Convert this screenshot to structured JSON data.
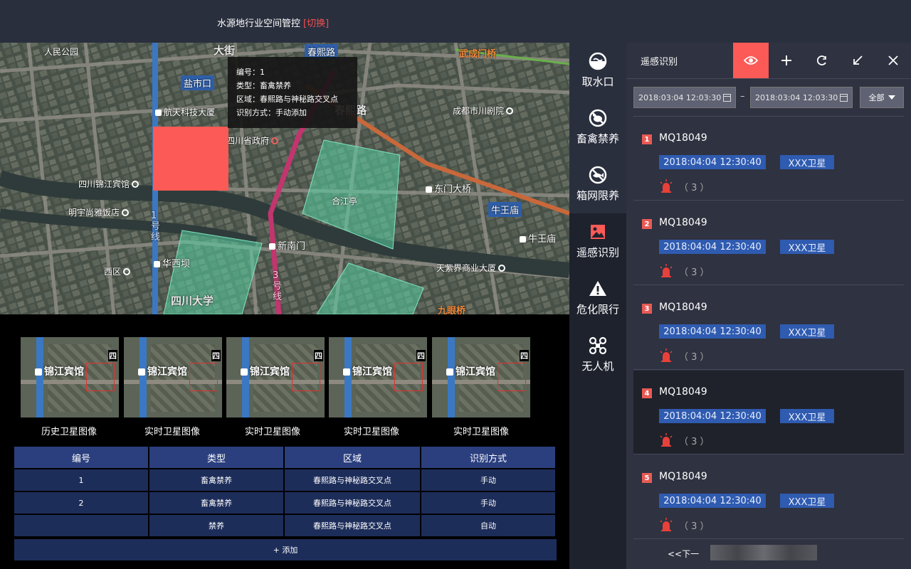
{
  "header": {
    "title": "水源地行业空间管控",
    "switch": "[切换]"
  },
  "map": {
    "labels": {
      "renmin_park": "人民公园",
      "da_jie": "大街",
      "chunxi_road_top": "春熙路",
      "wucheng_bridge": "武成门桥",
      "yanshikou": "盐市口",
      "aerospace_tower": "航天科技大厦",
      "chunxi_road_mid": "春熙路",
      "chengdu_theater": "成都市川剧院",
      "sichuan_gov": "四川省政府",
      "jinjiang_hotel": "四川锦江宾馆",
      "hejiang_pavilion": "合江亭",
      "dongmen_bridge": "东门大桥",
      "mingyu_hotel": "明宇尚雅饭店",
      "line1": "1号线",
      "niuwang_temple_badge": "牛王庙",
      "niuwang_temple": "牛王庙",
      "xinnanmen": "新南门",
      "huaxiba": "华西坝",
      "line3": "3号线",
      "xiqu": "西区",
      "tianzijie": "天紫界商业大厦",
      "sichuan_uni": "四川大学",
      "jiuyan_bridge": "九眼桥"
    },
    "tooltip": {
      "line1": "编号：1",
      "line2": "类型：畜禽禁养",
      "line3": "区域：春熙路与神秘路交叉点",
      "line4": "识别方式：手动添加"
    }
  },
  "thumbnails": [
    {
      "name": "锦江宾馆",
      "corner": "四",
      "caption": "历史卫星图像"
    },
    {
      "name": "锦江宾馆",
      "corner": "四",
      "caption": "实时卫星图像"
    },
    {
      "name": "锦江宾馆",
      "corner": "四",
      "caption": "实时卫星图像"
    },
    {
      "name": "锦江宾馆",
      "corner": "四",
      "caption": "实时卫星图像"
    },
    {
      "name": "锦江宾馆",
      "corner": "四",
      "caption": "实时卫星图像"
    }
  ],
  "table": {
    "headers": [
      "编号",
      "类型",
      "区域",
      "识别方式"
    ],
    "rows": [
      [
        "1",
        "畜禽禁养",
        "春熙路与神秘路交叉点",
        "手动"
      ],
      [
        "2",
        "畜禽禁养",
        "春熙路与神秘路交叉点",
        "手动"
      ],
      [
        "",
        "禁养",
        "春熙路与神秘路交叉点",
        "自动"
      ]
    ],
    "add_label": "+ 添加"
  },
  "sidenav": [
    {
      "label": "取水口",
      "icon": "water-intake-icon"
    },
    {
      "label": "畜禽禁养",
      "icon": "livestock-ban-icon"
    },
    {
      "label": "箱网限养",
      "icon": "cage-limit-icon"
    },
    {
      "label": "遥感识别",
      "icon": "remote-sensing-icon"
    },
    {
      "label": "危化限行",
      "icon": "hazard-warning-icon"
    },
    {
      "label": "无人机",
      "icon": "drone-icon"
    }
  ],
  "panel": {
    "title": "遥感识别",
    "date_from": "2018:03:04 12:03:30",
    "date_to": "2018:03:04 12:03:30",
    "dash": "–",
    "filter": "全部",
    "items": [
      {
        "num": "1",
        "code": "MQ18049",
        "time": "2018:04:04 12:30:40",
        "sat": "XXX卫星",
        "count": "（ 3 ）"
      },
      {
        "num": "2",
        "code": "MQ18049",
        "time": "2018:04:04 12:30:40",
        "sat": "XXX卫星",
        "count": "（ 3 ）"
      },
      {
        "num": "3",
        "code": "MQ18049",
        "time": "2018:04:04 12:30:40",
        "sat": "XXX卫星",
        "count": "（ 3 ）"
      },
      {
        "num": "4",
        "code": "MQ18049",
        "time": "2018:04:04 12:30:40",
        "sat": "XXX卫星",
        "count": "（ 3 ）"
      },
      {
        "num": "5",
        "code": "MQ18049",
        "time": "2018:04:04 12:30:40",
        "sat": "XXX卫星",
        "count": "（ 3 ）"
      }
    ],
    "pager_prev": "<<下一"
  },
  "colors": {
    "accent": "#fb5a56",
    "tag_blue": "#2f5bb0",
    "table_cell": "#1d2d5a",
    "nav_bg": "#2a2f3e"
  }
}
